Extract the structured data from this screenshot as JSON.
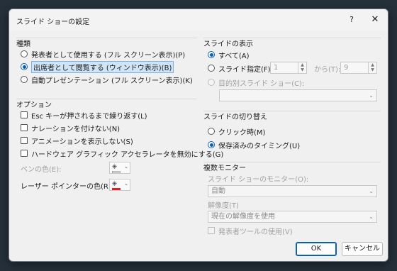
{
  "title": "スライド ショーの設定",
  "titlebar": {
    "help": "?",
    "close": "✕"
  },
  "type_group": {
    "title": "種類",
    "options": [
      {
        "label": "発表者として使用する (フル スクリーン表示)(P)",
        "selected": false
      },
      {
        "label": "出席者として閲覧する (ウィンドウ表示)(B)",
        "selected": true
      },
      {
        "label": "自動プレゼンテーション (フル スクリーン表示)(K)",
        "selected": false
      }
    ]
  },
  "options_group": {
    "title": "オプション",
    "checks": [
      {
        "label": "Esc キーが押されるまで繰り返す(L)",
        "checked": false
      },
      {
        "label": "ナレーションを付けない(N)",
        "checked": false
      },
      {
        "label": "アニメーションを表示しない(S)",
        "checked": false
      },
      {
        "label": "ハードウェア グラフィック アクセラレータを無効にする(G)",
        "checked": false
      }
    ],
    "pen_color_label": "ペンの色(E):",
    "pen_color": "#ffffff",
    "laser_color_label": "レーザー ポインターの色(R):",
    "laser_color": "#e02020"
  },
  "show_slides": {
    "title": "スライドの表示",
    "all_label": "すべて(A)",
    "range_label": "スライド指定(F):",
    "from_value": "1",
    "to_label": "から(T):",
    "to_value": "9",
    "custom_label": "目的別スライド ショー(C):",
    "custom_value": ""
  },
  "advance": {
    "title": "スライドの切り替え",
    "options": [
      {
        "label": "クリック時(M)",
        "selected": false
      },
      {
        "label": "保存済みのタイミング(U)",
        "selected": true
      }
    ]
  },
  "monitors": {
    "title": "複数モニター",
    "monitor_label": "スライド ショーのモニター(O):",
    "monitor_value": "自動",
    "resolution_label": "解像度(T)",
    "resolution_value": "現在の解像度を使用",
    "presenter_view_label": "発表者ツールの使用(V)"
  },
  "buttons": {
    "ok": "OK",
    "cancel": "キャンセル"
  }
}
